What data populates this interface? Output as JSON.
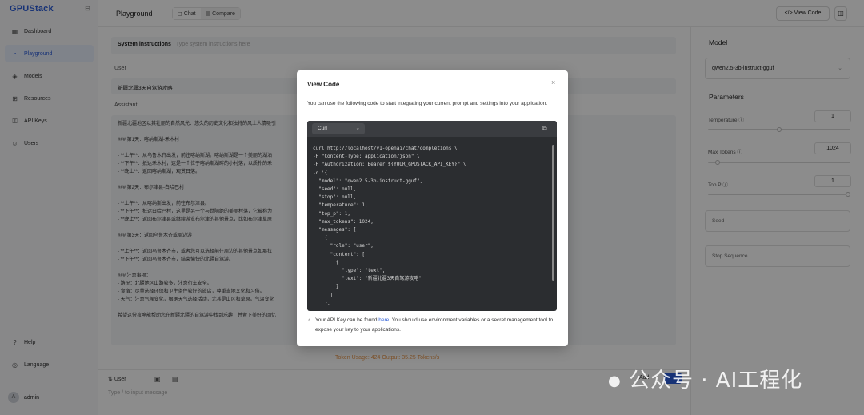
{
  "app": {
    "logo": "GPUStack"
  },
  "sidebar": {
    "items": [
      {
        "label": "Dashboard",
        "icon": "dashboard-icon",
        "active": false
      },
      {
        "label": "Playground",
        "icon": "playground-icon",
        "active": true
      },
      {
        "label": "Models",
        "icon": "models-icon",
        "active": false
      },
      {
        "label": "Resources",
        "icon": "resources-icon",
        "active": false
      },
      {
        "label": "API Keys",
        "icon": "key-icon",
        "active": false
      },
      {
        "label": "Users",
        "icon": "users-icon",
        "active": false
      }
    ],
    "bottom": [
      {
        "label": "Help",
        "icon": "help-icon"
      },
      {
        "label": "Language",
        "icon": "globe-icon"
      }
    ],
    "user": {
      "initial": "A",
      "name": "admin"
    }
  },
  "topbar": {
    "title": "Playground",
    "tabs": [
      "Chat",
      "Compare"
    ],
    "view_code": "View Code"
  },
  "chat": {
    "system_label": "System instructions",
    "system_placeholder": "Type system instructions here",
    "user_role": "User",
    "user_message": "新疆北疆3天自驾游攻略",
    "assistant_role": "Assistant",
    "assistant_lines": [
      "新疆北疆地区以其壮丽的自然风光、悠久的历史文化和独特的风土人情吸引",
      "",
      "### 第1天：喀纳斯湖-禾木村",
      "",
      "- **上午**：从乌鲁木齐出发，前往喀纳斯湖。喀纳斯湖是一个美丽的湖泊",
      "- **下午**：抵达禾木村，这是一个位于喀纳斯湖畔的小村落，以质朴的禾",
      "- **晚上**：返回喀纳斯湖，观赏日落。",
      "",
      "### 第2天：布尔津县-白哈巴村",
      "",
      "- **上午**：从喀纳斯出发，前往布尔津县。",
      "- **下午**：抵达白哈巴村，这里是另一个与世隔绝的美丽村落，它被称为",
      "- **晚上**：返回布尔津县或继续游览布尔津的其他景点，比如布尔津草原",
      "",
      "### 第3天：返回乌鲁木齐或周边游",
      "",
      "- **上午**：返回乌鲁木齐市，或者您可以选择前往周边的其他景点如那拉",
      "- **下午**：返回乌鲁木齐市，结束愉快的北疆自驾游。",
      "",
      "### 注意事项：",
      "- 路况：北疆地区山路较多，注意行车安全。",
      "- 食宿：尽量选择环保和卫生条件较好的旅店，尊重当地文化和习俗。",
      "- 天气：注意气候变化，根据天气选择活动，尤其是山区和草原。气温变化",
      "",
      "希望这份攻略能帮助您在新疆北疆的自驾游中找到乐趣，并留下美好的回忆"
    ],
    "usage": "Token Usage: 424    Output: 35.25 Tokens/s",
    "input_role": "User",
    "input_placeholder": "Type / to input message",
    "add_label": "Add"
  },
  "params": {
    "model_heading": "Model",
    "model_value": "qwen2.5-3b-instruct-gguf",
    "params_heading": "Parameters",
    "items": [
      {
        "label": "Temperature",
        "value": "1",
        "fraction": 0.5
      },
      {
        "label": "Max Tokens",
        "value": "1024",
        "fraction": 0.05
      },
      {
        "label": "Top P",
        "value": "1",
        "fraction": 1.0
      }
    ],
    "seed_placeholder": "Seed",
    "stop_placeholder": "Stop Sequence"
  },
  "modal": {
    "title": "View Code",
    "close": "×",
    "description": "You can use the following code to start integrating your current prompt and settings into your application.",
    "language": "Curl",
    "code_lines": [
      "curl http://localhost/v1-openai/chat/completions \\",
      "-H \"Content-Type: application/json\" \\",
      "-H \"Authorization: Bearer ${YOUR_GPUSTACK_API_KEY}\" \\",
      "-d '{",
      "  \"model\": \"qwen2.5-3b-instruct-gguf\",",
      "  \"seed\": null,",
      "  \"stop\": null,",
      "  \"temperature\": 1,",
      "  \"top_p\": 1,",
      "  \"max_tokens\": 1024,",
      "  \"messages\": [",
      "    {",
      "      \"role\": \"user\",",
      "      \"content\": [",
      "        {",
      "          \"type\": \"text\",",
      "          \"text\": \"新疆北疆3天自驾游攻略\"",
      "        }",
      "      ]",
      "    },"
    ],
    "footer_pre": "Your API Key can be found ",
    "footer_link": "here",
    "footer_post": ". You should use environment variables or a secret management tool to expose your key to your applications."
  },
  "watermark": "公众号 · AI工程化",
  "colors": {
    "accent": "#2a5bd7",
    "usage": "#e8964a",
    "code_bg": "#2b2d30"
  }
}
